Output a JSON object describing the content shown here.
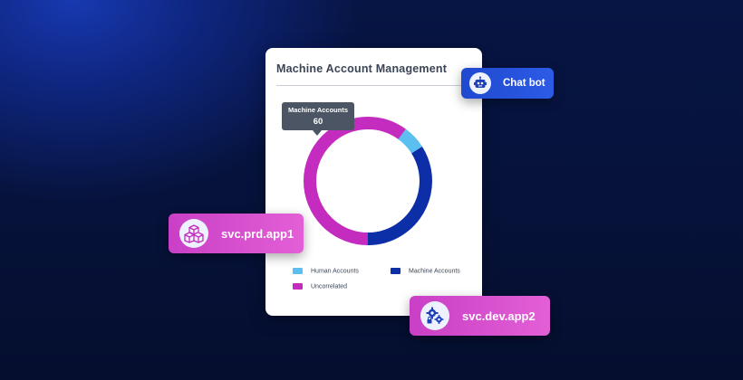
{
  "card": {
    "title": "Machine Account Management",
    "tooltip": {
      "label": "Machine Accounts",
      "value": "60"
    }
  },
  "chart_data": {
    "type": "pie",
    "categories": [
      "Human Accounts",
      "Machine Accounts",
      "Uncorrelated"
    ],
    "values": [
      6,
      34,
      60
    ],
    "colors": [
      "#5bc0ef",
      "#0c2fa8",
      "#c42cbf"
    ],
    "legend": "bottom"
  },
  "badges": {
    "chatbot": {
      "label": "Chat bot",
      "icon": "robot-icon"
    },
    "prd": {
      "label": "svc.prd.app1",
      "icon": "cubes-icon"
    },
    "dev": {
      "label": "svc.dev.app2",
      "icon": "gears-lock-icon"
    }
  },
  "colors": {
    "magenta": "#c42cbf",
    "navy": "#0c2fa8",
    "sky": "#5bc0ef",
    "bg": "#06123a"
  }
}
